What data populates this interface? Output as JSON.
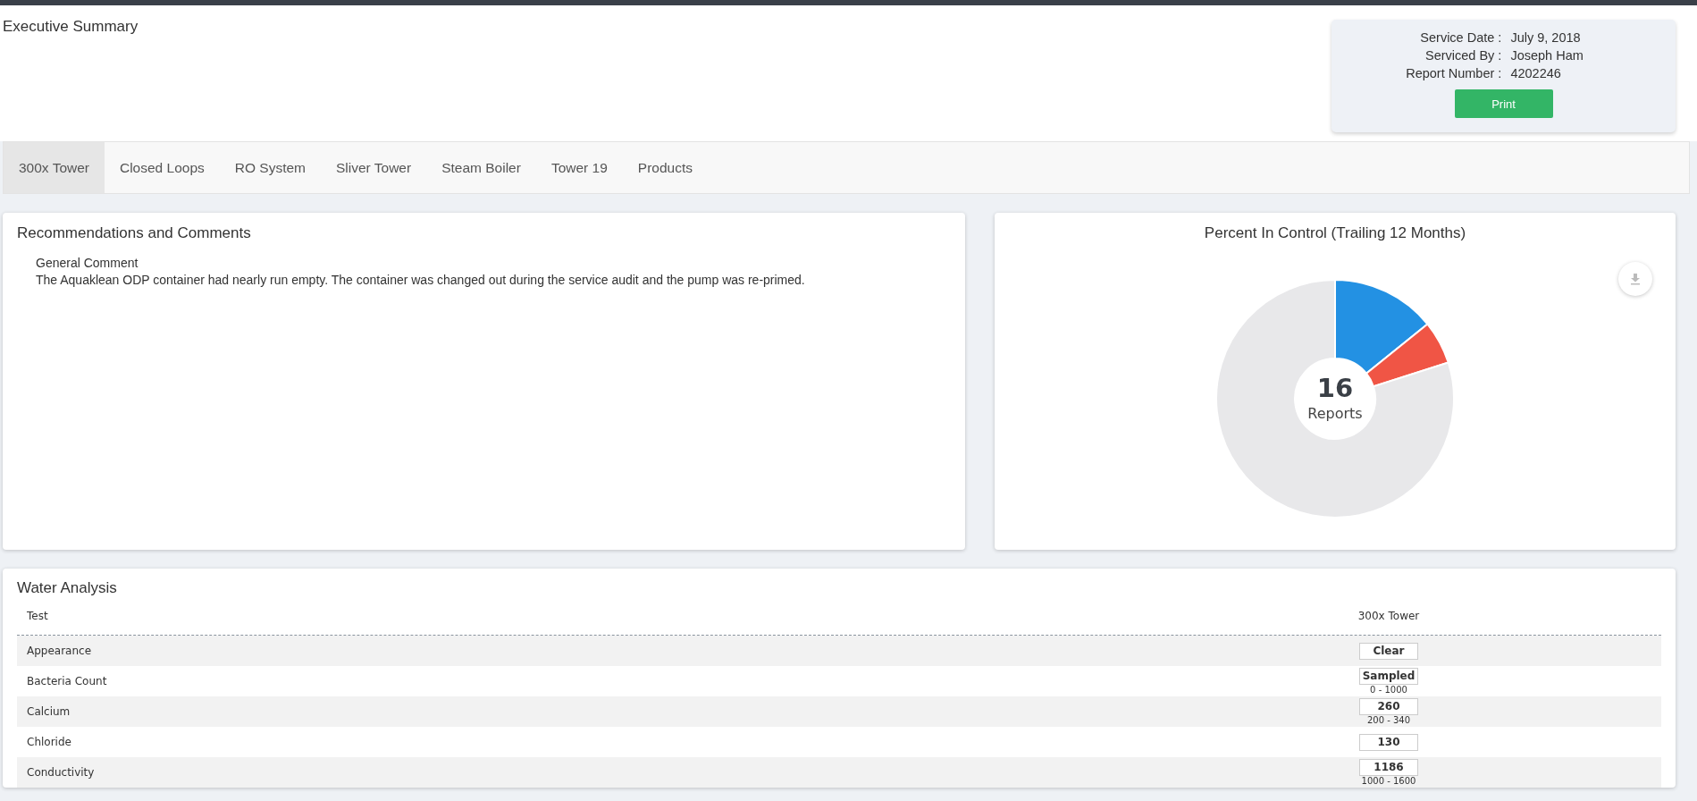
{
  "page_title": "Executive Summary",
  "service_info": [
    {
      "label": "Service Date :",
      "value": "July 9, 2018"
    },
    {
      "label": "Serviced By :",
      "value": "Joseph Ham"
    },
    {
      "label": "Report Number :",
      "value": "4202246"
    }
  ],
  "print_button": "Print",
  "tabs": [
    {
      "label": "300x Tower",
      "selected": true
    },
    {
      "label": "Closed Loops",
      "selected": false
    },
    {
      "label": "RO System",
      "selected": false
    },
    {
      "label": "Sliver Tower",
      "selected": false
    },
    {
      "label": "Steam Boiler",
      "selected": false
    },
    {
      "label": "Tower 19",
      "selected": false
    },
    {
      "label": "Products",
      "selected": false
    }
  ],
  "recommendations": {
    "title": "Recommendations and Comments",
    "comment_heading": "General Comment",
    "comment": "The Aquaklean ODP container had nearly run empty. The container was changed out during the service audit and the pump was re-primed."
  },
  "percent_in_control": {
    "title": "Percent In Control (Trailing 12 Months)",
    "center_value": "16",
    "center_label": "Reports"
  },
  "water_analysis": {
    "title": "Water Analysis",
    "columns": [
      "Test",
      "300x Tower"
    ],
    "rows": [
      {
        "test": "Appearance",
        "value": "Clear"
      },
      {
        "test": "Bacteria Count",
        "value": "Sampled",
        "range": "0 - 1000"
      },
      {
        "test": "Calcium",
        "value": "260",
        "range": "200 - 340"
      },
      {
        "test": "Chloride",
        "value": "130"
      },
      {
        "test": "Conductivity",
        "value": "1186",
        "range": "1000 - 1600"
      }
    ]
  }
}
